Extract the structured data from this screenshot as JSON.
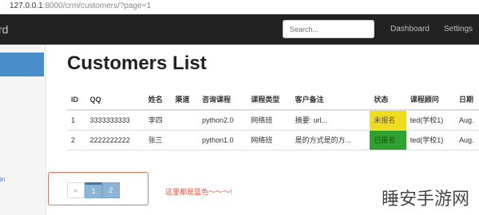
{
  "browser": {
    "url_host": "127.0.0.1",
    "url_path": ":8000/crm/customers/?page=1"
  },
  "navbar": {
    "brand": "rd",
    "search_placeholder": "Search...",
    "links": [
      "Dashboard",
      "Settings"
    ]
  },
  "sidebar": {
    "link_text": "in"
  },
  "page": {
    "title": "Customers List"
  },
  "table": {
    "headers": [
      "ID",
      "QQ",
      "姓名",
      "渠道",
      "咨询课程",
      "课程类型",
      "客户备注",
      "状态",
      "课程顾问",
      "日期"
    ],
    "rows": [
      [
        "1",
        "3333333333",
        "李四",
        "",
        "python2.0",
        "网络班",
        "摘要: url...",
        "未报名",
        "ted(学校1)",
        "Aug."
      ],
      [
        "2",
        "2222222222",
        "张三",
        "",
        "python1.0",
        "网络班",
        "是的方式是的方...",
        "已报名",
        "ted(学校1)",
        "Aug."
      ]
    ]
  },
  "pagination": {
    "prev": "«",
    "pages": [
      "1",
      "2"
    ]
  },
  "annotation": {
    "text": "这里都是蓝色～～～!"
  },
  "watermark": {
    "text": "睡安手游网"
  },
  "colors": {
    "status_unenrolled": "#f0dc1e",
    "status_enrolled": "#2fa22f",
    "sidebar_active": "#4a8dcc",
    "annotation": "#e2523c"
  }
}
